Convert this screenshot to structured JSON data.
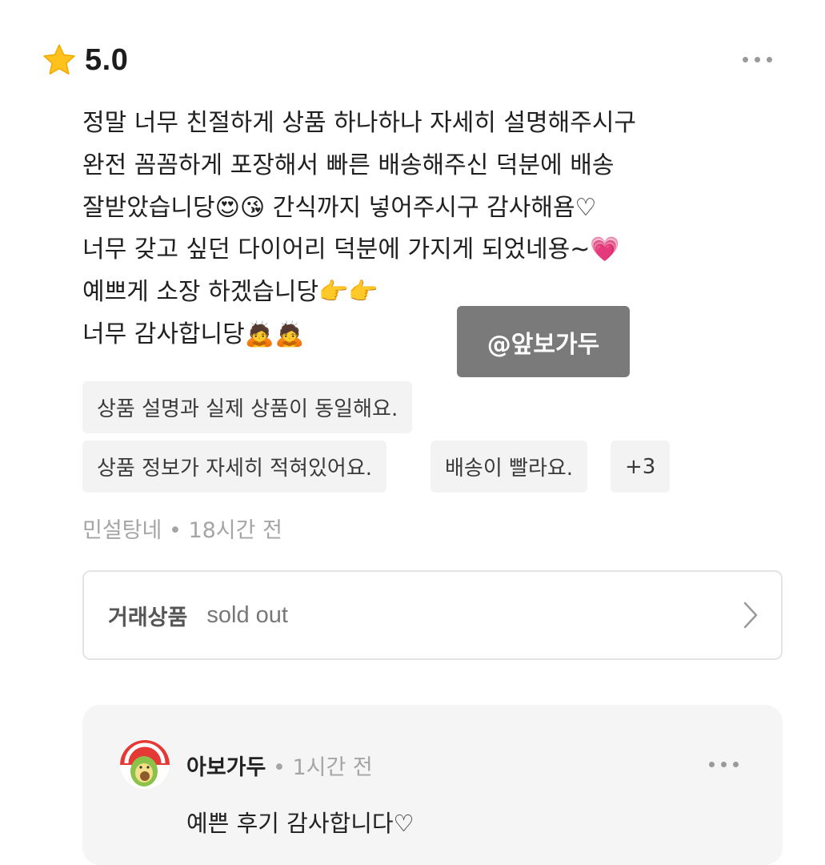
{
  "review": {
    "rating": "5.0",
    "lines": [
      "정말 너무 친절하게 상품 하나하나 자세히 설명해주시구",
      "완전 꼼꼼하게 포장해서 빠른 배송해주신 덕분에 배송",
      "잘받았습니당😍😘 간식까지 넣어주시구 감사해욤♡",
      "너무 갖고 싶던 다이어리 덕분에 가지게 되었네용~💗",
      "예쁘게 소장 하겠습니당👉👉",
      "너무 감사합니당🙇🙇"
    ],
    "watermark": "@앞보가두",
    "tags": [
      "상품 설명과 실제 상품이 동일해요.",
      "상품 정보가 자세히 적혀있어요.",
      "배송이 빨라요.",
      "+3"
    ],
    "meta": "민설탕네 • 18시간 전"
  },
  "deal": {
    "label": "거래상품",
    "value": "sold out"
  },
  "reply": {
    "author": "아보가두",
    "time": " • 1시간 전",
    "text": "예쁜 후기 감사합니다♡"
  },
  "icons": {
    "star": "star-icon",
    "more": "more-options-icon",
    "chevron": "chevron-right-icon"
  },
  "colors": {
    "star": "#FFC21C",
    "tag_bg": "#F3F3F3",
    "meta_text": "#A5A5A5",
    "reply_bg": "#F5F5F5",
    "watermark_bg": "#7A7A7A"
  }
}
